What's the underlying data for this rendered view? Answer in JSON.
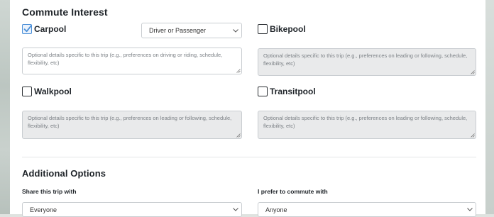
{
  "commute_interest": {
    "title": "Commute Interest",
    "carpool": {
      "label": "Carpool",
      "checked": true,
      "role_select": "Driver or Passenger",
      "details_placeholder": "Optional details specific to this trip (e.g., preferences on driving or riding, schedule, flexibility, etc)"
    },
    "bikepool": {
      "label": "Bikepool",
      "checked": false,
      "details_placeholder": "Optional details specific to this trip (e.g., preferences on leading or following, schedule, flexibility, etc)"
    },
    "walkpool": {
      "label": "Walkpool",
      "checked": false,
      "details_placeholder": "Optional details specific to this trip (e.g., preferences on leading or following, schedule, flexibility, etc)"
    },
    "transitpool": {
      "label": "Transitpool",
      "checked": false,
      "details_placeholder": "Optional details specific to this trip (e.g., preferences on leading or following, schedule, flexibility, etc)"
    }
  },
  "additional_options": {
    "title": "Additional Options",
    "share_with": {
      "label": "Share this trip with",
      "value": "Everyone"
    },
    "commute_with": {
      "label": "I prefer to commute with",
      "value": "Anyone"
    }
  },
  "colors": {
    "checkbox_accent": "#4a8fd8",
    "disabled_field": "#e9eaeb"
  },
  "icons": [
    "checkmark-icon",
    "chevron-down-icon",
    "resize-grip-icon"
  ]
}
